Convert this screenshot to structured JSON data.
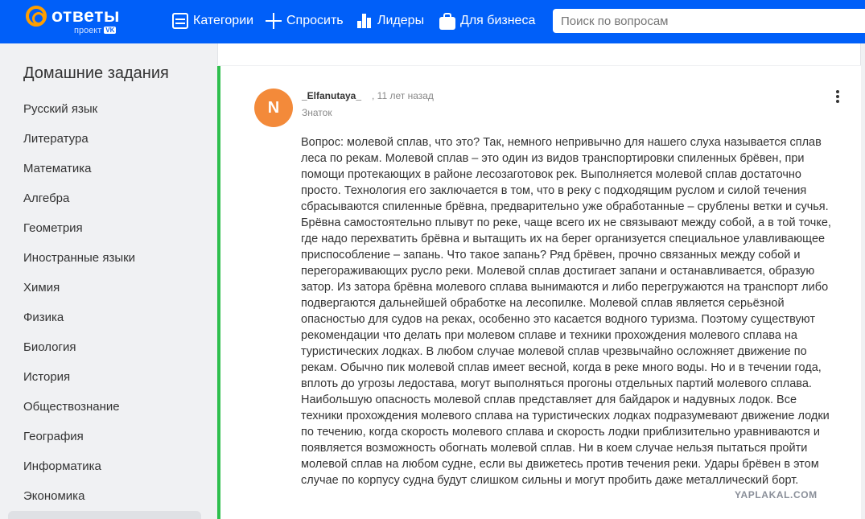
{
  "header": {
    "logo_text": "ответы",
    "logo_sub": "проект",
    "logo_badge": "VK",
    "nav": [
      {
        "label": "Категории",
        "icon": "categories-icon"
      },
      {
        "label": "Спросить",
        "icon": "plus-icon"
      },
      {
        "label": "Лидеры",
        "icon": "leaders-chart-icon"
      },
      {
        "label": "Для бизнеса",
        "icon": "briefcase-icon"
      }
    ],
    "search_placeholder": "Поиск по вопросам"
  },
  "sidebar": {
    "title": "Домашние задания",
    "items": [
      "Русский язык",
      "Литература",
      "Математика",
      "Алгебра",
      "Геометрия",
      "Иностранные языки",
      "Химия",
      "Физика",
      "Биология",
      "История",
      "Обществознание",
      "География",
      "Информатика",
      "Экономика"
    ]
  },
  "answer": {
    "avatar_letter": "N",
    "author": "_Elfanutaya_",
    "time": ", 11 лет назад",
    "rank": "Знаток",
    "text": "Вопрос: молевой сплав, что это? Так, немного непривычно для нашего слуха называется сплав леса по рекам. Молевой сплав – это один из видов транспортировки спиленных брёвен, при помощи протекающих в районе лесозаготовок рек. Выполняется молевой сплав достаточно просто. Технология его заключается в том, что в реку с подходящим руслом и силой течения сбрасываются спиленные брёвна, предварительно уже обработанные – срублены ветки и сучья. Брёвна самостоятельно плывут по реке, чаще всего их не связывают между собой, а в той точке, где надо перехватить брёвна и вытащить их на берег организуется специальное улавливающее приспособление – запань. Что такое запань? Ряд брёвен, прочно связанных между собой и перегораживающих русло реки. Молевой сплав достигает запани и останавливается, образую затор. Из затора брёвна молевого сплава вынимаются и либо перегружаются на транспорт либо подвергаются дальнейшей обработке на лесопилке. Молевой сплав является серьёзной опасностью для судов на реках, особенно это касается водного туризма. Поэтому существуют рекомендации что делать при молевом сплаве и техники прохождения молевого сплава на туристических лодках. В любом случае молевой сплав чрезвычайно осложняет движение по рекам. Обычно пик молевой сплав имеет весной, когда в реке много воды. Но и в течении года, вплоть до угрозы ледостава, могут выполняться прогоны отдельных партий молевого сплава. Наибольшую опасность молевой сплав представляет для байдарок и надувных лодок. Все техники прохождения молевого сплава на туристических лодках подразумевают движение лодки по течению, когда скорость молевого сплава и скорость лодки приблизительно уравниваются и появляется возможность обогнать молевой сплав. Ни в коем случае нельзя пытаться пройти молевой сплав на любом судне, если вы движетесь против течения реки. Удары брёвен в этом случае по корпусу судна будут слишком сильны и могут пробить даже металлический борт."
  },
  "watermark": "YAPLAKAL.COM",
  "colors": {
    "header_bg": "#005ff9",
    "logo_accent": "#ff9e00",
    "answer_border": "#2fbf4e",
    "avatar_bg": "#f38a3a"
  }
}
